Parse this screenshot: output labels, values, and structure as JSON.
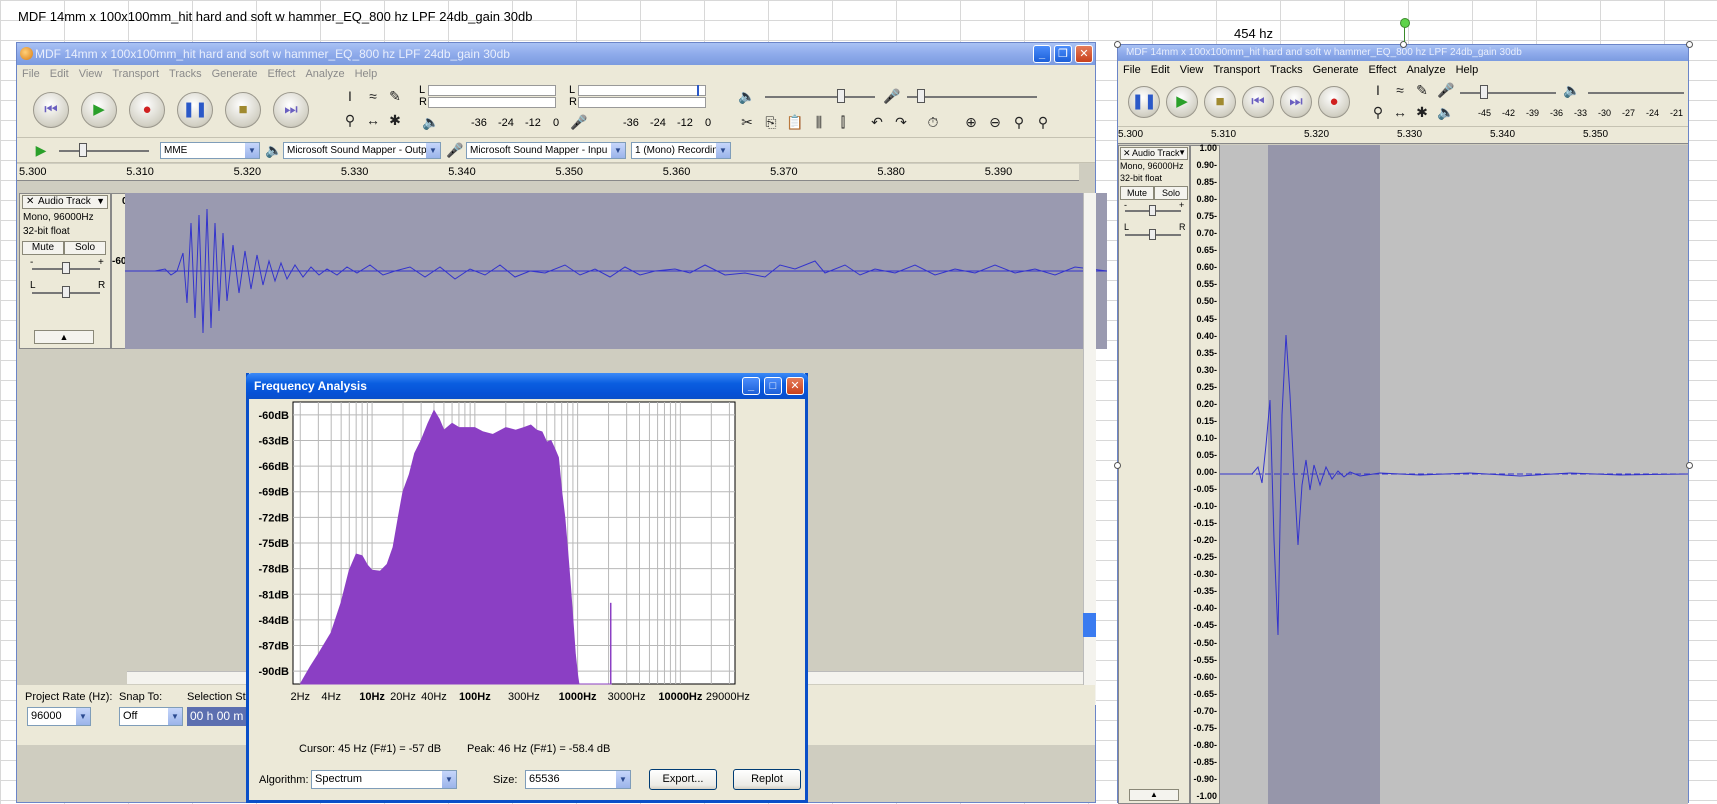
{
  "sheet": {
    "cell_text": "MDF 14mm x 100x100mm_hit hard and soft w hammer_EQ_800 hz LPF 24db_gain 30db",
    "annotation": "454 hz"
  },
  "main_window": {
    "title": "MDF 14mm x 100x100mm_hit hard and soft w hammer_EQ_800 hz LPF 24db_gain 30db",
    "menu": [
      "File",
      "Edit",
      "View",
      "Transport",
      "Tracks",
      "Generate",
      "Effect",
      "Analyze",
      "Help"
    ],
    "meter_labels": [
      "-36",
      "-24",
      "-12",
      "0",
      "-36",
      "-24",
      "-12",
      "0"
    ],
    "meter_channels": [
      "L",
      "R",
      "L",
      "R"
    ],
    "device": {
      "host": "MME",
      "output": "Microsoft Sound Mapper - Outpu",
      "input": "Microsoft Sound Mapper - Inpu",
      "channels": "1 (Mono) Recordin"
    },
    "ruler": [
      "5.300",
      "5.310",
      "5.320",
      "5.330",
      "5.340",
      "5.350",
      "5.360",
      "5.370",
      "5.380",
      "5.390"
    ],
    "track": {
      "name": "Audio Track",
      "format": "Mono, 96000Hz",
      "bitdepth": "32-bit float",
      "mute": "Mute",
      "solo": "Solo",
      "scale_top": "0",
      "scale_mid": "-60",
      "gain_minus": "-",
      "gain_plus": "+",
      "pan_l": "L",
      "pan_r": "R"
    },
    "bottom": {
      "rate_label": "Project Rate (Hz):",
      "rate_value": "96000",
      "snap_label": "Snap To:",
      "snap_value": "Off",
      "selection_label": "Selection Sta",
      "selection_value": "00 h 00 m"
    }
  },
  "freq_dialog": {
    "title": "Frequency Analysis",
    "cursor": "Cursor: 45 Hz (F#1) = -57 dB",
    "peak": "Peak: 46 Hz (F#1) = -58.4 dB",
    "algorithm_label": "Algorithm:",
    "algorithm_value": "Spectrum",
    "size_label": "Size:",
    "size_value": "65536",
    "export_label": "Export...",
    "replot_label": "Replot"
  },
  "right_window": {
    "title": "MDF 14mm x 100x100mm_hit hard and soft w hammer_EQ_800 hz LPF 24db_gain 30db",
    "menu": [
      "File",
      "Edit",
      "View",
      "Transport",
      "Tracks",
      "Generate",
      "Effect",
      "Analyze",
      "Help"
    ],
    "meter_labels": [
      "-45",
      "-42",
      "-39",
      "-36",
      "-33",
      "-30",
      "-27",
      "-24",
      "-21"
    ],
    "ruler": [
      "5.300",
      "5.310",
      "5.320",
      "5.330",
      "5.340",
      "5.350"
    ],
    "track": {
      "name": "Audio Track",
      "format": "Mono, 96000Hz",
      "bitdepth": "32-bit float",
      "mute": "Mute",
      "solo": "Solo",
      "gain_minus": "-",
      "gain_plus": "+",
      "pan_l": "L",
      "pan_r": "R"
    },
    "scale": [
      "1.00",
      "0.90-",
      "0.85-",
      "0.80-",
      "0.75-",
      "0.70-",
      "0.65-",
      "0.60-",
      "0.55-",
      "0.50-",
      "0.45-",
      "0.40-",
      "0.35-",
      "0.30-",
      "0.25-",
      "0.20-",
      "0.15-",
      "0.10-",
      "0.05-",
      "0.00-",
      "-0.05-",
      "-0.10-",
      "-0.15-",
      "-0.20-",
      "-0.25-",
      "-0.30-",
      "-0.35-",
      "-0.40-",
      "-0.45-",
      "-0.50-",
      "-0.55-",
      "-0.60-",
      "-0.65-",
      "-0.70-",
      "-0.75-",
      "-0.80-",
      "-0.85-",
      "-0.90-",
      "-1.00"
    ]
  },
  "chart_data": {
    "type": "area",
    "x_scale": "log",
    "x_tick_labels": [
      "2Hz",
      "4Hz",
      "10Hz",
      "20Hz",
      "40Hz",
      "100Hz",
      "300Hz",
      "1000Hz",
      "3000Hz",
      "10000Hz",
      "29000Hz"
    ],
    "x_tick_values": [
      2,
      4,
      10,
      20,
      40,
      100,
      300,
      1000,
      3000,
      10000,
      29000
    ],
    "y_tick_labels": [
      "-60dB",
      "-63dB",
      "-66dB",
      "-69dB",
      "-72dB",
      "-75dB",
      "-78dB",
      "-81dB",
      "-84dB",
      "-87dB",
      "-90dB"
    ],
    "ylim": [
      -91.5,
      -58.5
    ],
    "xlim": [
      1.7,
      34000
    ],
    "grid": true,
    "color": "#8b3fc4",
    "x": [
      2,
      2.5,
      3,
      4,
      5,
      6,
      7,
      8,
      9,
      10,
      12,
      14,
      16,
      18,
      20,
      23,
      26,
      30,
      35,
      40,
      45,
      50,
      60,
      70,
      80,
      100,
      120,
      150,
      200,
      250,
      300,
      350,
      400,
      450,
      500,
      550,
      600,
      650,
      700,
      750,
      800,
      850,
      900,
      950,
      1000,
      1030,
      1060,
      1100,
      2100,
      2150
    ],
    "values": [
      -91.5,
      -89.5,
      -88,
      -85.5,
      -82,
      -78.2,
      -76.3,
      -76.5,
      -77.6,
      -78.2,
      -78.3,
      -77.5,
      -75.5,
      -72,
      -69,
      -67,
      -64.5,
      -63,
      -61,
      -59.5,
      -60.5,
      -61.8,
      -61,
      -61.5,
      -61.5,
      -61.5,
      -62,
      -62.3,
      -61.5,
      -61.8,
      -61.5,
      -61.2,
      -61.8,
      -62,
      -63.2,
      -63,
      -64,
      -65,
      -69,
      -72,
      -76,
      -80,
      -84,
      -88,
      -90.5,
      -91.5,
      -91.5,
      -91.5,
      -91.5,
      -91.5
    ],
    "spike": {
      "x": 2100,
      "value": -82
    }
  },
  "colors": {
    "track_bg": "#9a9ab0",
    "waveform": "#3333cc",
    "selection_bg": "#9696aa",
    "spectrum": "#8b3fc4",
    "xp_blue": "#0a5ee0"
  }
}
